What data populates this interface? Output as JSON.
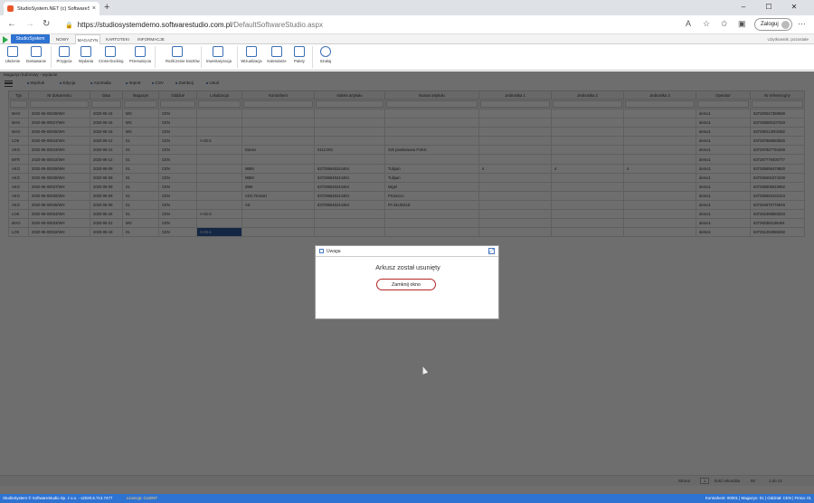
{
  "browser": {
    "tab_title": "StudioSystem.NET (c) SoftwareStudio",
    "url_host": "https://studiosystemdemo.softwarestudio.com.pl",
    "url_path": "/DefaultSoftwareStudio.aspx",
    "login_label": "Zaloguj"
  },
  "app": {
    "brand_button": "StudioSystem",
    "tabs": [
      "NOWY",
      "MAGAZYN",
      "KARTOTEKI",
      "INFORMACJE"
    ],
    "active_tab": "MAGAZYN",
    "user_label": "Użytkownik: pozostałe",
    "ribbon": [
      {
        "label": "Ułożenie",
        "icon": "layout-icon"
      },
      {
        "label": "Dostawanie",
        "icon": "folder-icon"
      },
      {
        "label": "Przyjęcia",
        "icon": "receive-icon"
      },
      {
        "label": "Wydania",
        "icon": "issue-icon"
      },
      {
        "label": "Cross-Docking",
        "icon": "refresh-icon"
      },
      {
        "label": "Przesunięcia",
        "icon": "undo-icon"
      },
      {
        "label": "Rozliczenie kosztów",
        "icon": "calculator-icon"
      },
      {
        "label": "Inwentaryzacja",
        "icon": "edit-doc-icon"
      },
      {
        "label": "Wizualizacja",
        "icon": "grid-icon"
      },
      {
        "label": "Kalendarze",
        "icon": "calendar-icon"
      },
      {
        "label": "Palety",
        "icon": "pallet-icon"
      },
      {
        "label": "Szukaj",
        "icon": "search-icon"
      }
    ]
  },
  "page": {
    "breadcrumb": "Magazyn buforowy - wydanie",
    "toolbar": [
      "Wydruk",
      "Edycja",
      "Anomalia",
      "Import",
      "CSV",
      "Zamknij",
      "Usuń"
    ]
  },
  "grid": {
    "columns": [
      "Typ",
      "Nr dokumentu",
      "Data",
      "Magazyn",
      "Oddział",
      "Lokalizacja",
      "Kontrahent",
      "Indeks artykułu",
      "Nazwa artykułu",
      "Jednostka 1",
      "Jednostka 2",
      "Jednostka 3",
      "Operator",
      "Nr referencyjny"
    ],
    "rows": [
      [
        "MAG",
        "2020-06-00048/WH",
        "2020-06-16",
        "MG",
        "CEN",
        "",
        "",
        "",
        "",
        "",
        "",
        "",
        "demo1",
        "637290547369599"
      ],
      [
        "MAG",
        "2020-06-00047/WH",
        "2020-06-16",
        "MG",
        "CEN",
        "",
        "",
        "",
        "",
        "",
        "",
        "",
        "demo1",
        "637290580107319"
      ],
      [
        "MAG",
        "2020-06-00045/WH",
        "2020-06-15",
        "MG",
        "CEN",
        "",
        "",
        "",
        "",
        "",
        "",
        "",
        "demo1",
        "637290213002392"
      ],
      [
        "LOK",
        "2020-06-00044/WH",
        "2020-06-12",
        "01",
        "CEN",
        "A-02-2",
        "",
        "",
        "",
        "",
        "",
        "",
        "demo1",
        "637287656583925"
      ],
      [
        "AKO",
        "2020-06-00043/WH",
        "2020-06-12",
        "01",
        "CEN",
        "",
        "Danex",
        "0112.001",
        "Szk piaskowana FUKS",
        "",
        "",
        "",
        "demo1",
        "637287827794209"
      ],
      [
        "MTR",
        "2020-06-00042/WH",
        "2020-06-12",
        "01",
        "CEN",
        "",
        "",
        "",
        "",
        "",
        "",
        "",
        "demo1",
        "637287779400777"
      ],
      [
        "AKO",
        "2020-06-00039/WH",
        "2020-06-09",
        "01",
        "CEN",
        "",
        "MBM",
        "637295645244464",
        "Tulipan",
        "4",
        "4",
        "4",
        "demo1",
        "637285696479800"
      ],
      [
        "AKO",
        "2020-06-00038/WH",
        "2020-06-09",
        "01",
        "CEN",
        "",
        "MBM",
        "637295645244464",
        "Tulipan",
        "",
        "",
        "",
        "demo1",
        "637285691574239"
      ],
      [
        "AKO",
        "2020-06-00037/WH",
        "2020-06-09",
        "01",
        "CEN",
        "",
        "ZMK",
        "637295645244464",
        "Migel",
        "",
        "",
        "",
        "demo1",
        "637285605915992"
      ],
      [
        "AKO",
        "2020-06-00036/WH",
        "2020-06-09",
        "01",
        "CEN",
        "",
        "AGC Romart",
        "637295645244464",
        "Prosecco",
        "",
        "",
        "",
        "demo1",
        "637285592233104"
      ],
      [
        "AKO",
        "2020-06-00035/WH",
        "2020-06-08",
        "01",
        "CEN",
        "",
        "AS",
        "637295645244464",
        "PA ZŁUDZLE",
        "",
        "",
        "",
        "demo1",
        "637284670776549"
      ],
      [
        "LOK",
        "2020-06-00034/WH",
        "2020-05-26",
        "01",
        "CEN",
        "A-02-3",
        "",
        "",
        "",
        "",
        "",
        "",
        "demo1",
        "637262368893203"
      ],
      [
        "MAG",
        "2020-05-00033/WH",
        "2020-05-22",
        "MG",
        "CEN",
        "",
        "",
        "",
        "",
        "",
        "",
        "",
        "demo1",
        "637260361158404"
      ],
      [
        "LOK",
        "2020-05-00032/WH",
        "2020-05-18",
        "01",
        "CEN",
        "A-03-1",
        "",
        "",
        "",
        "",
        "",
        "",
        "demo1",
        "637251294986302"
      ]
    ],
    "selected_cell": {
      "row": 13,
      "col": 5
    }
  },
  "status": {
    "page_label": "Strona",
    "page_number": "1",
    "per_page_label": "Ilość rekordów",
    "per_page": "50",
    "range": "1 do 14"
  },
  "footer": {
    "left": "StudioSystem © SoftwareStudio Sp. z o.o. - v2020.6.713.7477",
    "license": "Licencja: CLIENT",
    "right": "Kontrahent: 00001 | Magazyn: 01 | Oddział: CEN | Firma: 01"
  },
  "modal": {
    "title": "Uwaga",
    "message": "Arkusz został usunięty",
    "button_label": "Zamknij okno"
  }
}
